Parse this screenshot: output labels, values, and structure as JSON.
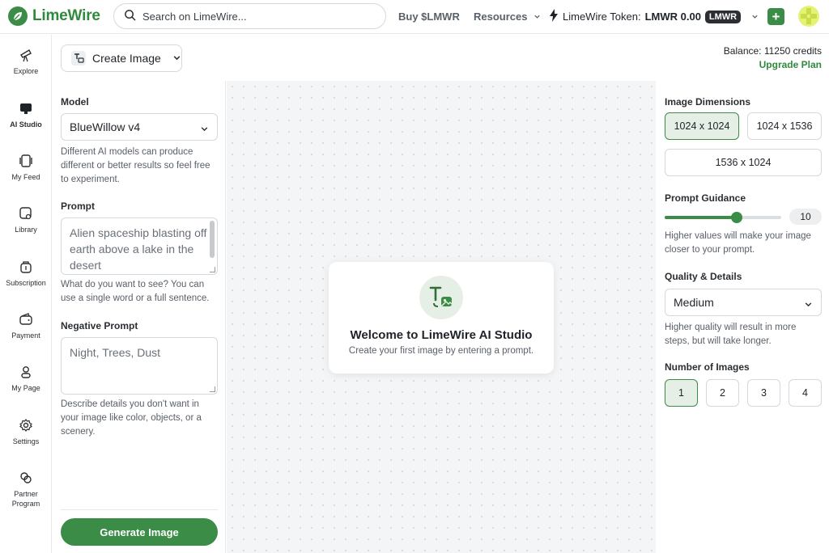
{
  "app": {
    "brand": "LimeWire",
    "brand_color": "#3a8c46"
  },
  "topbar": {
    "search_placeholder": "Search on LimeWire...",
    "buy_label": "Buy $LMWR",
    "resources_label": "Resources",
    "token_label": "LimeWire Token:",
    "token_value": "LMWR 0.00",
    "token_badge": "LMWR"
  },
  "rail": {
    "items": [
      {
        "label": "Explore",
        "icon": "telescope-icon"
      },
      {
        "label": "AI Studio",
        "icon": "monitor-icon",
        "active": true
      },
      {
        "label": "My Feed",
        "icon": "feed-icon"
      },
      {
        "label": "Library",
        "icon": "library-icon"
      },
      {
        "label": "Subscription",
        "icon": "subscription-icon"
      },
      {
        "label": "Payment",
        "icon": "wallet-icon"
      },
      {
        "label": "My Page",
        "icon": "user-icon"
      },
      {
        "label": "Settings",
        "icon": "gear-icon"
      },
      {
        "label": "Partner",
        "label2": "Program",
        "icon": "link-icon"
      }
    ]
  },
  "header": {
    "create_label": "Create Image",
    "balance": "Balance: 11250 credits",
    "upgrade": "Upgrade Plan"
  },
  "form": {
    "model_label": "Model",
    "model_value": "BlueWillow v4",
    "model_help": "Different AI models can produce different or better results so feel free to experiment.",
    "prompt_label": "Prompt",
    "prompt_value": "Alien spaceship blasting off earth above a lake in the desert",
    "prompt_help": "What do you want to see? You can use a single word or a full sentence.",
    "negative_label": "Negative Prompt",
    "negative_placeholder": "Night, Trees, Dust",
    "negative_help": "Describe details you don't want in your image like color, objects, or a scenery.",
    "generate_label": "Generate Image"
  },
  "canvas": {
    "welcome_title": "Welcome to LimeWire AI Studio",
    "welcome_sub": "Create your first image by entering a prompt."
  },
  "settings": {
    "dimensions_label": "Image Dimensions",
    "dimensions": [
      "1024 x 1024",
      "1024 x 1536",
      "1536 x 1024"
    ],
    "dimensions_selected": "1024 x 1024",
    "guidance_label": "Prompt Guidance",
    "guidance_value": "10",
    "guidance_fraction": 0.62,
    "guidance_help": "Higher values will make your image closer to your prompt.",
    "quality_label": "Quality & Details",
    "quality_value": "Medium",
    "quality_help": "Higher quality will result in more steps, but will take longer.",
    "count_label": "Number of Images",
    "counts": [
      "1",
      "2",
      "3",
      "4"
    ],
    "count_selected": "1"
  }
}
